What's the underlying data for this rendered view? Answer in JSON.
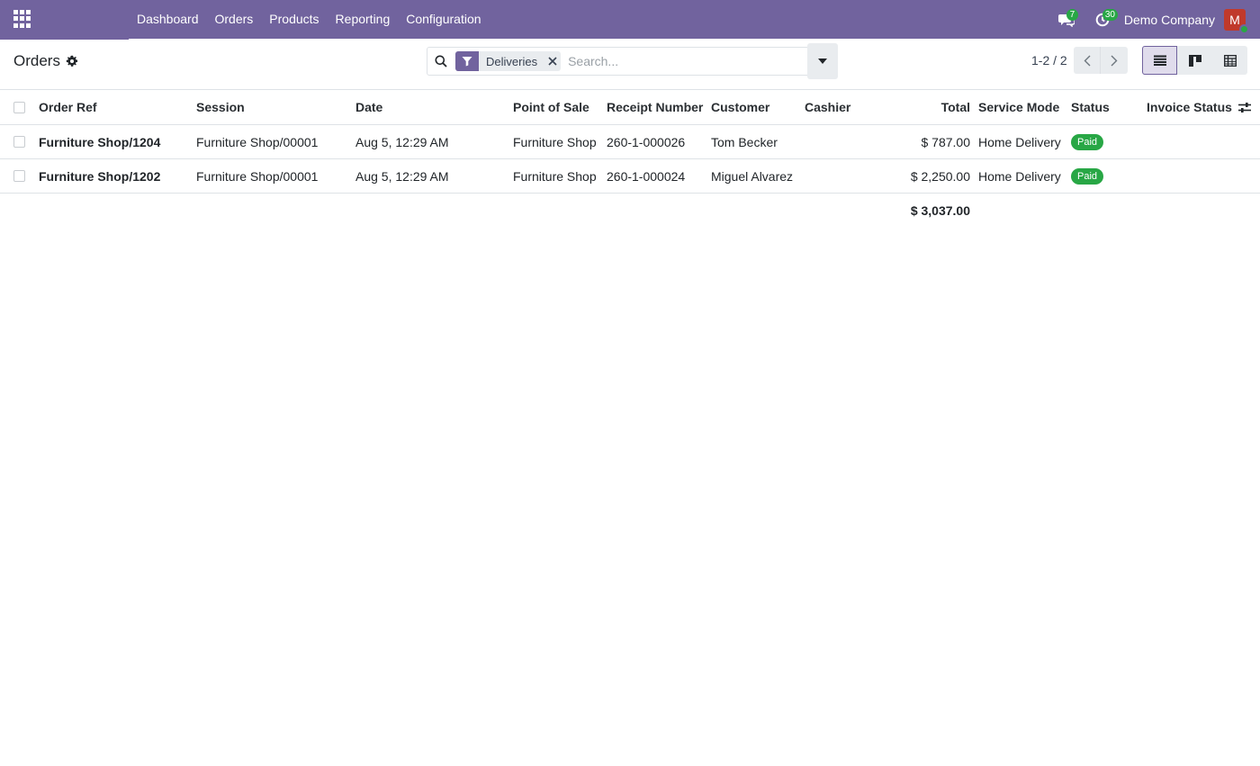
{
  "navbar": {
    "menu": [
      "Dashboard",
      "Orders",
      "Products",
      "Reporting",
      "Configuration"
    ],
    "messages_count": "7",
    "activities_count": "30",
    "company": "Demo Company",
    "avatar_letter": "M"
  },
  "control_panel": {
    "title": "Orders",
    "facet_label": "Deliveries",
    "search_placeholder": "Search...",
    "pager": "1-2 / 2"
  },
  "table": {
    "columns": {
      "order_ref": "Order Ref",
      "session": "Session",
      "date": "Date",
      "point_of_sale": "Point of Sale",
      "receipt_number": "Receipt Number",
      "customer": "Customer",
      "cashier": "Cashier",
      "total": "Total",
      "service_mode": "Service Mode",
      "status": "Status",
      "invoice_status": "Invoice Status"
    },
    "rows": [
      {
        "order_ref": "Furniture Shop/1204",
        "session": "Furniture Shop/00001",
        "date": "Aug 5, 12:29 AM",
        "point_of_sale": "Furniture Shop",
        "receipt_number": "260-1-000026",
        "customer": "Tom Becker",
        "cashier": "",
        "total": "$ 787.00",
        "service_mode": "Home Delivery",
        "status": "Paid",
        "invoice_status": ""
      },
      {
        "order_ref": "Furniture Shop/1202",
        "session": "Furniture Shop/00001",
        "date": "Aug 5, 12:29 AM",
        "point_of_sale": "Furniture Shop",
        "receipt_number": "260-1-000024",
        "customer": "Miguel Alvarez",
        "cashier": "",
        "total": "$ 2,250.00",
        "service_mode": "Home Delivery",
        "status": "Paid",
        "invoice_status": ""
      }
    ],
    "grand_total": "$ 3,037.00"
  },
  "colors": {
    "brand": "#71639e",
    "status_paid": "#28a745"
  }
}
